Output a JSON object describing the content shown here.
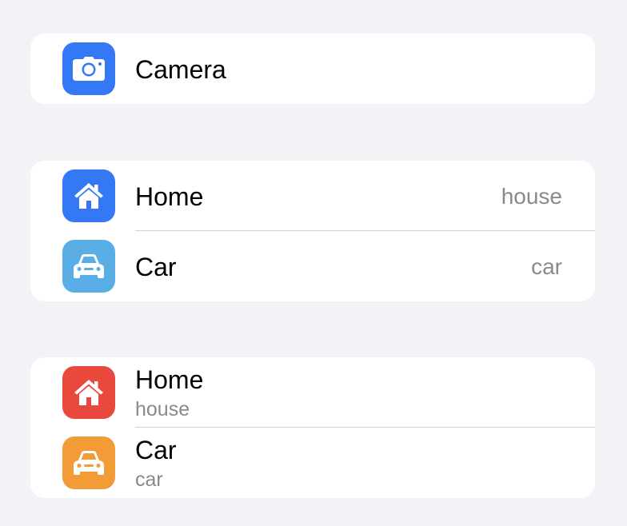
{
  "colors": {
    "background": "#f2f2f7",
    "card": "#ffffff",
    "secondary_text": "#8a8a8e",
    "separator": "#d1d1d6"
  },
  "group1": {
    "items": [
      {
        "icon": "camera-icon",
        "icon_color": "#3478f6",
        "title": "Camera"
      }
    ]
  },
  "group2": {
    "items": [
      {
        "icon": "house-icon",
        "icon_color": "#3478f6",
        "title": "Home",
        "value": "house"
      },
      {
        "icon": "car-icon",
        "icon_color": "#5aaee6",
        "title": "Car",
        "value": "car"
      }
    ]
  },
  "group3": {
    "items": [
      {
        "icon": "house-icon",
        "icon_color": "#e9493c",
        "title": "Home",
        "subtitle": "house"
      },
      {
        "icon": "car-icon",
        "icon_color": "#f29c38",
        "title": "Car",
        "subtitle": "car"
      }
    ]
  }
}
